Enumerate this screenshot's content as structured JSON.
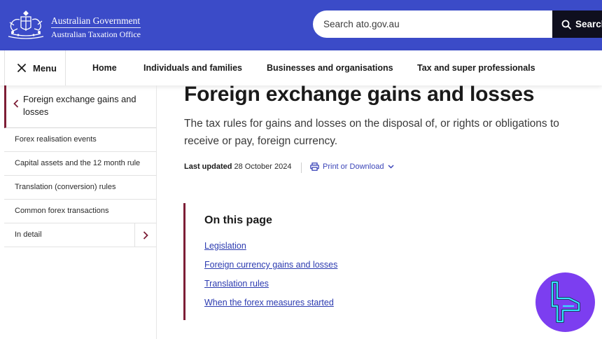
{
  "header": {
    "brand_line1": "Australian Government",
    "brand_line2": "Australian Taxation Office",
    "search_placeholder": "Search ato.gov.au",
    "search_button": "Search",
    "colors": {
      "header_bg": "#3b4bc8",
      "search_button_bg": "#0f0f1e"
    }
  },
  "nav": {
    "menu_label": "Menu",
    "links": [
      "Home",
      "Individuals and families",
      "Businesses and organisations",
      "Tax and super professionals"
    ]
  },
  "sidebar": {
    "current": "Foreign exchange gains and losses",
    "items": [
      "Forex realisation events",
      "Capital assets and the 12 month rule",
      "Translation (conversion) rules",
      "Common forex transactions",
      "In detail"
    ]
  },
  "main": {
    "title": "Foreign exchange gains and losses",
    "lead": "The tax rules for gains and losses on the disposal of, or rights or obligations to receive or pay, foreign currency.",
    "last_updated_label": "Last updated",
    "last_updated_value": "28 October 2024",
    "print_label": "Print or Download",
    "toc_heading": "On this page",
    "toc_links": [
      "Legislation",
      "Foreign currency gains and losses",
      "Translation rules",
      "When the forex measures started"
    ],
    "accent_color": "#7d1e36",
    "link_color": "#2c3bb0"
  },
  "icons": {
    "crest": "coat-of-arms-icon",
    "search": "search-icon",
    "close": "close-icon",
    "back": "chevron-left-icon",
    "expand": "chevron-right-icon",
    "print": "printer-icon",
    "dropdown": "chevron-down-icon",
    "watermark": "site-logo-icon"
  }
}
